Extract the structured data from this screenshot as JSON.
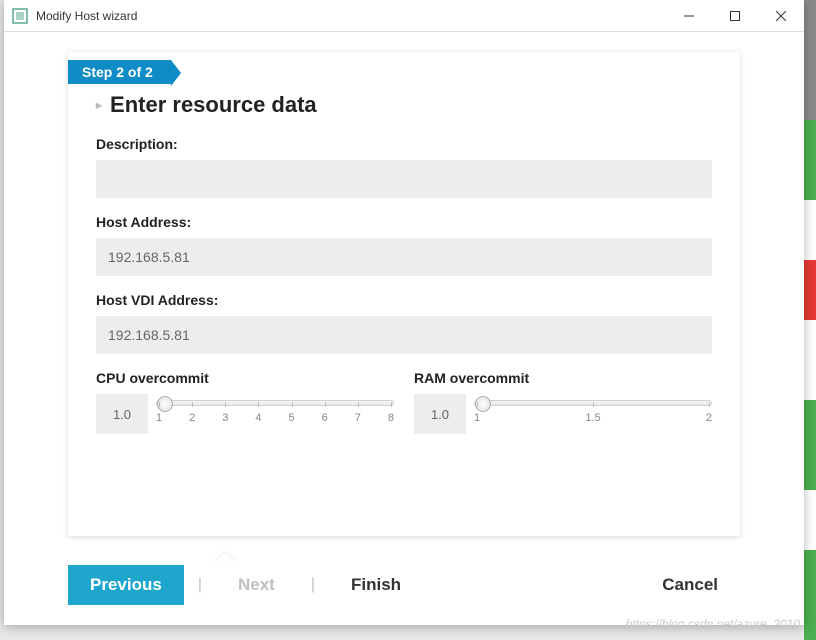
{
  "window": {
    "title": "Modify Host wizard"
  },
  "wizard": {
    "step_badge": "Step 2 of 2",
    "heading": "Enter resource data"
  },
  "form": {
    "description_label": "Description:",
    "description_value": "",
    "host_address_label": "Host Address:",
    "host_address_value": "192.168.5.81",
    "host_vdi_label": "Host VDI Address:",
    "host_vdi_value": "192.168.5.81"
  },
  "sliders": {
    "cpu": {
      "label": "CPU overcommit",
      "value": "1.0",
      "ticks": [
        "1",
        "2",
        "3",
        "4",
        "5",
        "6",
        "7",
        "8"
      ]
    },
    "ram": {
      "label": "RAM overcommit",
      "value": "1.0",
      "ticks": [
        "1",
        "1.5",
        "2"
      ]
    }
  },
  "footer": {
    "previous": "Previous",
    "next": "Next",
    "finish": "Finish",
    "cancel": "Cancel"
  },
  "watermark": "https://blog.csdn.net/azure_2010"
}
